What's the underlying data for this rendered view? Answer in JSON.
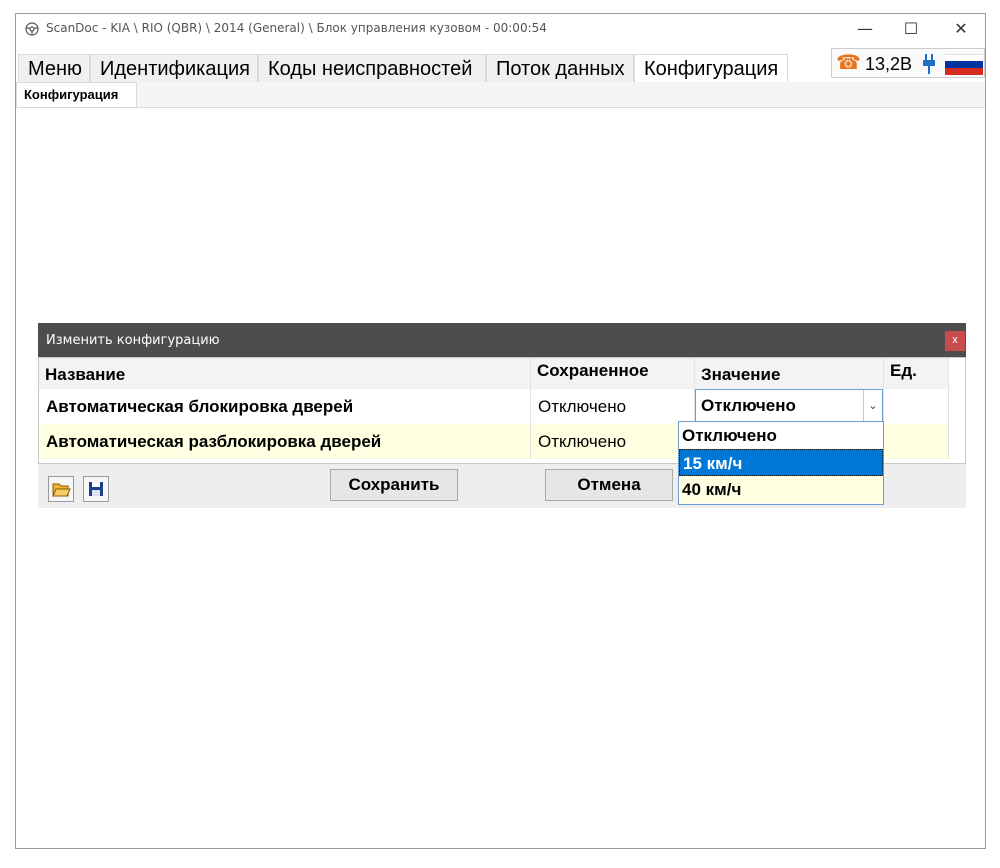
{
  "window": {
    "title": "ScanDoc - KIA \\ RIO (QBR) \\ 2014 (General) \\ Блок управления кузовом - 00:00:54",
    "controls": {
      "minimize": "—",
      "maximize": "☐",
      "close": "✕"
    }
  },
  "tabs": [
    {
      "label": "Меню"
    },
    {
      "label": "Идентификация"
    },
    {
      "label": "Коды неисправностей"
    },
    {
      "label": "Поток данных"
    },
    {
      "label": "Конфигурация",
      "active": true
    }
  ],
  "status": {
    "voltage": "13,2В",
    "phone_icon": "☎",
    "icons": [
      "phone-icon",
      "plug-icon",
      "russia-flag-icon"
    ],
    "flag_colors": [
      "#ffffff",
      "#0033a0",
      "#d52b1e"
    ]
  },
  "subtab": {
    "label": "Конфигурация"
  },
  "dialog": {
    "title": "Изменить конфигурацию",
    "close_label": "x",
    "columns": {
      "name": "Название",
      "saved": "Сохраненное",
      "value": "Значение",
      "unit": "Ед."
    },
    "rows": [
      {
        "name": "Автоматическая блокировка дверей",
        "saved": "Отключено",
        "value": "Отключено",
        "unit": ""
      },
      {
        "name": "Автоматическая разблокировка дверей",
        "saved": "Отключено",
        "value": "",
        "unit": ""
      }
    ],
    "combo_arrow": "⌄",
    "dropdown_options": [
      {
        "label": "Отключено",
        "state": "normal"
      },
      {
        "label": "15 км/ч",
        "state": "selected"
      },
      {
        "label": "40 км/ч",
        "state": "normal"
      }
    ],
    "buttons": {
      "save": "Сохранить",
      "cancel": "Отмена"
    },
    "tools": [
      "open-folder-icon",
      "save-disk-icon"
    ]
  },
  "colors": {
    "accent": "#0078d7",
    "row_highlight": "#ffffe1",
    "dialog_title_bg": "#4d4d4d",
    "close_red": "#c94b4b"
  }
}
